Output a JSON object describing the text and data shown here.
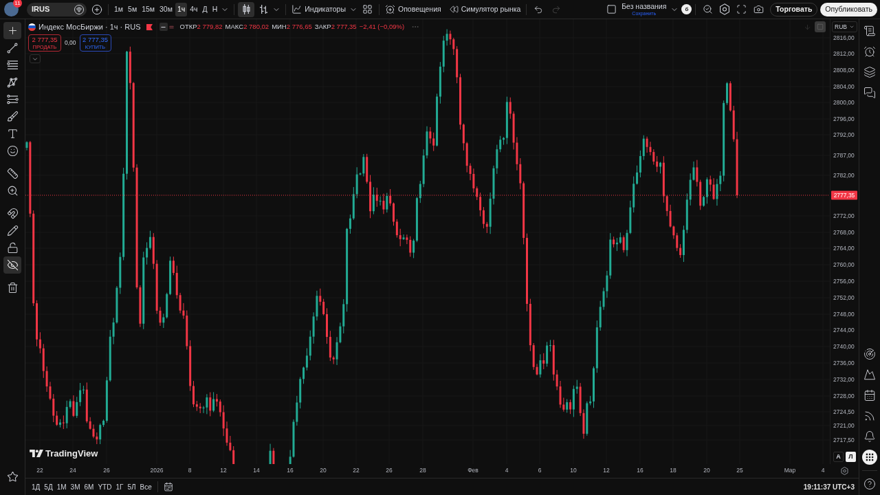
{
  "top_bar": {
    "avatar_badge": "11",
    "symbol": "IRUS",
    "intervals": [
      {
        "label": "1м",
        "selected": false
      },
      {
        "label": "5м",
        "selected": false
      },
      {
        "label": "15м",
        "selected": false
      },
      {
        "label": "30м",
        "selected": false
      },
      {
        "label": "1ч",
        "selected": true
      },
      {
        "label": "4ч",
        "selected": false
      },
      {
        "label": "Д",
        "selected": false
      },
      {
        "label": "Н",
        "selected": false
      }
    ],
    "candles_button": {
      "selected": true
    },
    "indicators": "Индикаторы",
    "alerts": "Оповещения",
    "replay": "Симулятор рынка",
    "undo": {
      "disabled": false
    },
    "redo": {
      "disabled": true
    },
    "layout": {
      "title": "Без названия",
      "subtitle": "Сохранить",
      "badge": "б"
    },
    "trade_button": "Торговать",
    "publish_button": "Опубликовать"
  },
  "left_toolbar": {
    "tools": [
      {
        "selected": true
      },
      {
        "selected": false
      },
      {
        "selected": false
      },
      {
        "selected": false
      },
      {
        "selected": false
      },
      {
        "selected": false
      },
      {
        "selected": false
      },
      {
        "selected": false
      },
      {
        "selected": false
      },
      {
        "selected": false
      },
      {
        "selected": false
      },
      {
        "selected": false
      },
      {
        "selected": false
      },
      {
        "selected": true
      },
      {
        "selected": false
      }
    ]
  },
  "legend": {
    "title": "Индекс МосБиржи · 1ч · RUS",
    "ohlc": [
      {
        "label": "ОТКР",
        "value": "2 779,82"
      },
      {
        "label": "МАКС",
        "value": "2 780,02"
      },
      {
        "label": "МИН",
        "value": "2 776,65"
      },
      {
        "label": "ЗАКР",
        "value": "2 777,35"
      }
    ],
    "change": "−2,41 (−0,09%)",
    "sell": {
      "price": "2 777,35",
      "label": "ПРОДАТЬ"
    },
    "spread": "0,00",
    "buy": {
      "price": "2 777,35",
      "label": "КУПИТЬ"
    }
  },
  "price_axis": {
    "currency": "RUB",
    "ticks": [
      "2816,00",
      "2812,00",
      "2808,00",
      "2804,00",
      "2800,00",
      "2796,00",
      "2792,00",
      "2787,00",
      "2782,00",
      "2772,00",
      "2768,00",
      "2764,00",
      "2760,00",
      "2756,00",
      "2752,00",
      "2748,00",
      "2744,00",
      "2740,00",
      "2736,00",
      "2732,00",
      "2728,00",
      "2724,50",
      "2721,00",
      "2717,50"
    ],
    "last_price": "2777,35",
    "scale_modes": [
      {
        "label": "A",
        "selected": false
      },
      {
        "label": "Л",
        "selected": true
      }
    ]
  },
  "time_axis": {
    "ticks": [
      "22",
      "24",
      "26",
      "2026",
      "8",
      "12",
      "14",
      "16",
      "20",
      "22",
      "26",
      "28",
      "Фев",
      "4",
      "6",
      "10",
      "12",
      "16",
      "18",
      "20",
      "25",
      "Мар",
      "4"
    ]
  },
  "logo": "TradingView",
  "bottom_bar": {
    "ranges": [
      "1Д",
      "5Д",
      "1М",
      "3М",
      "6М",
      "YTD",
      "1Г",
      "5Л",
      "Все"
    ],
    "clock": "19:11:37 UTC+3"
  }
}
